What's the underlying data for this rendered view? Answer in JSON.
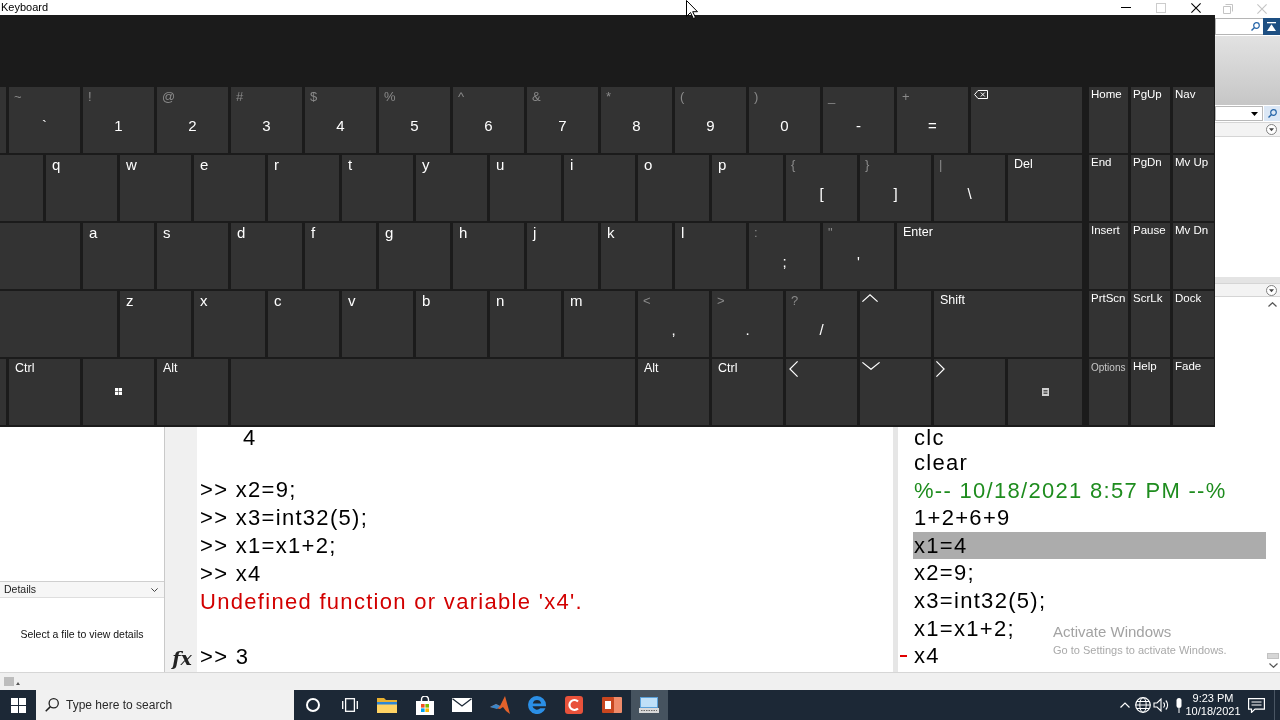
{
  "keyboard_window": {
    "title": "Keyboard",
    "controls": [
      {
        "kind": "minimize",
        "disabled": false
      },
      {
        "kind": "maximize",
        "disabled": true
      },
      {
        "kind": "close",
        "disabled": false
      }
    ],
    "main_rows": [
      [
        {
          "kind": "blank"
        },
        {
          "kind": "symbol",
          "shift": "~",
          "main": "`"
        },
        {
          "kind": "symbol",
          "shift": "!",
          "main": "1"
        },
        {
          "kind": "symbol",
          "shift": "@",
          "main": "2"
        },
        {
          "kind": "symbol",
          "shift": "#",
          "main": "3"
        },
        {
          "kind": "symbol",
          "shift": "$",
          "main": "4"
        },
        {
          "kind": "symbol",
          "shift": "%",
          "main": "5"
        },
        {
          "kind": "symbol",
          "shift": "^",
          "main": "6"
        },
        {
          "kind": "symbol",
          "shift": "&",
          "main": "7"
        },
        {
          "kind": "symbol",
          "shift": "*",
          "main": "8"
        },
        {
          "kind": "symbol",
          "shift": "(",
          "main": "9"
        },
        {
          "kind": "symbol",
          "shift": ")",
          "main": "0"
        },
        {
          "kind": "symbol",
          "shift": "_",
          "main": "-"
        },
        {
          "kind": "symbol",
          "shift": "+",
          "main": "="
        },
        {
          "kind": "backspace"
        }
      ],
      [
        {
          "kind": "blank"
        },
        {
          "kind": "letter",
          "main": "q"
        },
        {
          "kind": "letter",
          "main": "w"
        },
        {
          "kind": "letter",
          "main": "e"
        },
        {
          "kind": "letter",
          "main": "r"
        },
        {
          "kind": "letter",
          "main": "t"
        },
        {
          "kind": "letter",
          "main": "y"
        },
        {
          "kind": "letter",
          "main": "u"
        },
        {
          "kind": "letter",
          "main": "i"
        },
        {
          "kind": "letter",
          "main": "o"
        },
        {
          "kind": "letter",
          "main": "p"
        },
        {
          "kind": "symbol",
          "shift": "{",
          "main": "["
        },
        {
          "kind": "symbol",
          "shift": "}",
          "main": "]"
        },
        {
          "kind": "symbol",
          "shift": "|",
          "main": "\\"
        },
        {
          "kind": "label",
          "main": "Del"
        }
      ],
      [
        {
          "kind": "blank"
        },
        {
          "kind": "letter",
          "main": "a"
        },
        {
          "kind": "letter",
          "main": "s"
        },
        {
          "kind": "letter",
          "main": "d"
        },
        {
          "kind": "letter",
          "main": "f"
        },
        {
          "kind": "letter",
          "main": "g"
        },
        {
          "kind": "letter",
          "main": "h"
        },
        {
          "kind": "letter",
          "main": "j"
        },
        {
          "kind": "letter",
          "main": "k"
        },
        {
          "kind": "letter",
          "main": "l"
        },
        {
          "kind": "symbol",
          "shift": ":",
          "main": ";"
        },
        {
          "kind": "symbol",
          "shift": "\"",
          "main": "'"
        },
        {
          "kind": "label",
          "main": "Enter"
        }
      ],
      [
        {
          "kind": "blank"
        },
        {
          "kind": "letter",
          "main": "z"
        },
        {
          "kind": "letter",
          "main": "x"
        },
        {
          "kind": "letter",
          "main": "c"
        },
        {
          "kind": "letter",
          "main": "v"
        },
        {
          "kind": "letter",
          "main": "b"
        },
        {
          "kind": "letter",
          "main": "n"
        },
        {
          "kind": "letter",
          "main": "m"
        },
        {
          "kind": "symbol",
          "shift": "<",
          "main": ","
        },
        {
          "kind": "symbol",
          "shift": ">",
          "main": "."
        },
        {
          "kind": "symbol",
          "shift": "?",
          "main": "/"
        },
        {
          "kind": "arrow_up"
        },
        {
          "kind": "label",
          "main": "Shift"
        }
      ],
      [
        {
          "kind": "blank"
        },
        {
          "kind": "label",
          "main": "Ctrl"
        },
        {
          "kind": "windows"
        },
        {
          "kind": "label",
          "main": "Alt"
        },
        {
          "kind": "blank"
        },
        {
          "kind": "label",
          "main": "Alt"
        },
        {
          "kind": "label",
          "main": "Ctrl"
        },
        {
          "kind": "arrow_left"
        },
        {
          "kind": "arrow_down"
        },
        {
          "kind": "arrow_right"
        },
        {
          "kind": "menu"
        }
      ]
    ],
    "nav_rows": [
      [
        {
          "kind": "label",
          "main": "Home"
        },
        {
          "kind": "label",
          "main": "PgUp"
        },
        {
          "kind": "label",
          "main": "Nav"
        }
      ],
      [
        {
          "kind": "label",
          "main": "End"
        },
        {
          "kind": "label",
          "main": "PgDn"
        },
        {
          "kind": "label",
          "main": "Mv Up"
        }
      ],
      [
        {
          "kind": "label",
          "main": "Insert"
        },
        {
          "kind": "label",
          "main": "Pause"
        },
        {
          "kind": "label",
          "main": "Mv Dn"
        }
      ],
      [
        {
          "kind": "label",
          "main": "PrtScn"
        },
        {
          "kind": "label",
          "main": "ScrLk"
        },
        {
          "kind": "label",
          "main": "Dock"
        }
      ],
      [
        {
          "kind": "small_label",
          "main": "Options"
        },
        {
          "kind": "label",
          "main": "Help"
        },
        {
          "kind": "label",
          "main": "Fade"
        }
      ]
    ]
  },
  "app_window": {
    "title_controls": [
      {
        "kind": "restore",
        "disabled": true
      },
      {
        "kind": "close",
        "disabled": true
      }
    ],
    "details_panel": {
      "title": "Details",
      "message": "Select a file to view details"
    },
    "command_window": {
      "function_button": "fx",
      "lines": [
        {
          "kind": "output",
          "text": "4"
        },
        {
          "kind": "blank"
        },
        {
          "kind": "command",
          "text": ">> x2=9;"
        },
        {
          "kind": "command",
          "text": ">> x3=int32(5);"
        },
        {
          "kind": "command",
          "text": ">> x1=x1+2;"
        },
        {
          "kind": "command",
          "text": ">> x4"
        },
        {
          "kind": "error",
          "text": "Undefined function or variable 'x4'."
        },
        {
          "kind": "blank"
        },
        {
          "kind": "command",
          "text": ">> 3"
        }
      ]
    },
    "command_history": {
      "lines": [
        {
          "kind": "command",
          "text": "clc",
          "selected": false,
          "error": false
        },
        {
          "kind": "command",
          "text": "clear",
          "selected": false,
          "error": false
        },
        {
          "kind": "session",
          "text": "%-- 10/18/2021 8:57 PM --%",
          "selected": false,
          "error": false
        },
        {
          "kind": "command",
          "text": "1+2+6+9",
          "selected": false,
          "error": false
        },
        {
          "kind": "command",
          "text": "x1=4",
          "selected": true,
          "error": false
        },
        {
          "kind": "command",
          "text": "x2=9;",
          "selected": false,
          "error": false
        },
        {
          "kind": "command",
          "text": "x3=int32(5);",
          "selected": false,
          "error": false
        },
        {
          "kind": "command",
          "text": "x1=x1+2;",
          "selected": false,
          "error": false
        },
        {
          "kind": "command",
          "text": "x4",
          "selected": false,
          "error": true
        }
      ]
    }
  },
  "activation_notice": {
    "title": "Activate Windows",
    "subtitle": "Go to Settings to activate Windows."
  },
  "taskbar": {
    "search_placeholder": "Type here to search",
    "apps": [
      {
        "kind": "folder",
        "selected": false
      },
      {
        "kind": "store",
        "selected": false
      },
      {
        "kind": "mail",
        "selected": false
      },
      {
        "kind": "peak",
        "selected": false
      },
      {
        "kind": "swirl",
        "selected": false
      },
      {
        "kind": "arc_tile",
        "selected": false
      },
      {
        "kind": "slides",
        "selected": false
      },
      {
        "kind": "keyboard",
        "selected": true
      }
    ],
    "clock": {
      "time": "9:23 PM",
      "date": "10/18/2021"
    }
  }
}
